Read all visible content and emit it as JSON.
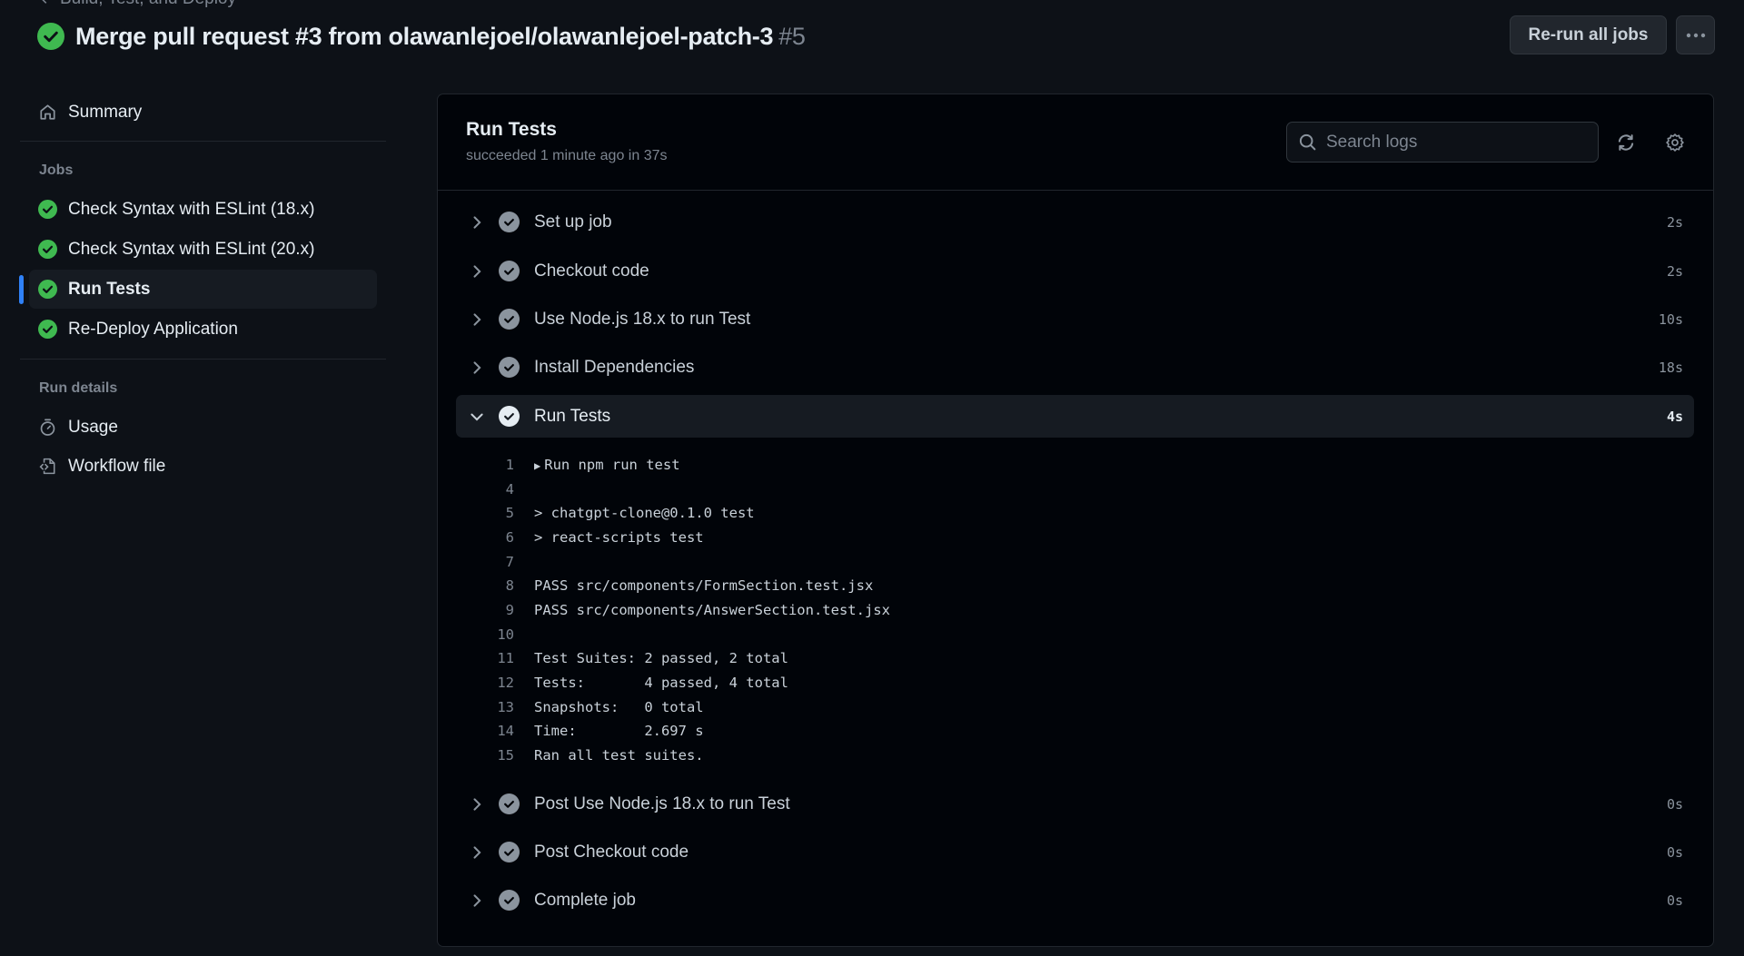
{
  "breadcrumb": {
    "label": "Build, Test, and Deploy"
  },
  "header": {
    "title": "Merge pull request #3 from olawanlejoel/olawanlejoel-patch-3",
    "run_number": "#5",
    "status_icon": "check-circle-fill-icon",
    "rerun_label": "Re-run all jobs",
    "more_icon": "kebab-horizontal-icon"
  },
  "sidebar": {
    "summary": {
      "label": "Summary",
      "icon": "home-icon"
    },
    "jobs_heading": "Jobs",
    "jobs": [
      {
        "label": "Check Syntax with ESLint (18.x)",
        "status": "success",
        "selected": false
      },
      {
        "label": "Check Syntax with ESLint (20.x)",
        "status": "success",
        "selected": false
      },
      {
        "label": "Run Tests",
        "status": "success",
        "selected": true
      },
      {
        "label": "Re-Deploy Application",
        "status": "success",
        "selected": false
      }
    ],
    "run_details_heading": "Run details",
    "run_details": [
      {
        "label": "Usage",
        "icon": "stopwatch-icon"
      },
      {
        "label": "Workflow file",
        "icon": "file-code-icon"
      }
    ]
  },
  "job": {
    "title": "Run Tests",
    "subtitle": "succeeded 1 minute ago in 37s",
    "search_placeholder": "Search logs",
    "search_value": "",
    "steps_before": [
      {
        "label": "Set up job",
        "duration": "2s"
      },
      {
        "label": "Checkout code",
        "duration": "2s"
      },
      {
        "label": "Use Node.js 18.x to run Test",
        "duration": "10s"
      },
      {
        "label": "Install Dependencies",
        "duration": "18s"
      }
    ],
    "expanded_step": {
      "label": "Run Tests",
      "duration": "4s"
    },
    "log_lines": [
      {
        "num": "1",
        "text": "Run npm run test",
        "collapsible": true
      },
      {
        "num": "4",
        "text": ""
      },
      {
        "num": "5",
        "text": "> chatgpt-clone@0.1.0 test"
      },
      {
        "num": "6",
        "text": "> react-scripts test"
      },
      {
        "num": "7",
        "text": ""
      },
      {
        "num": "8",
        "text": "PASS src/components/FormSection.test.jsx"
      },
      {
        "num": "9",
        "text": "PASS src/components/AnswerSection.test.jsx"
      },
      {
        "num": "10",
        "text": ""
      },
      {
        "num": "11",
        "text": "Test Suites: 2 passed, 2 total"
      },
      {
        "num": "12",
        "text": "Tests:       4 passed, 4 total"
      },
      {
        "num": "13",
        "text": "Snapshots:   0 total"
      },
      {
        "num": "14",
        "text": "Time:        2.697 s"
      },
      {
        "num": "15",
        "text": "Ran all test suites."
      }
    ],
    "steps_after": [
      {
        "label": "Post Use Node.js 18.x to run Test",
        "duration": "0s"
      },
      {
        "label": "Post Checkout code",
        "duration": "0s"
      },
      {
        "label": "Complete job",
        "duration": "0s"
      }
    ]
  },
  "colors": {
    "success": "#3fb950",
    "accent": "#2f81f7",
    "background": "#0d1117",
    "panel": "#010409"
  }
}
